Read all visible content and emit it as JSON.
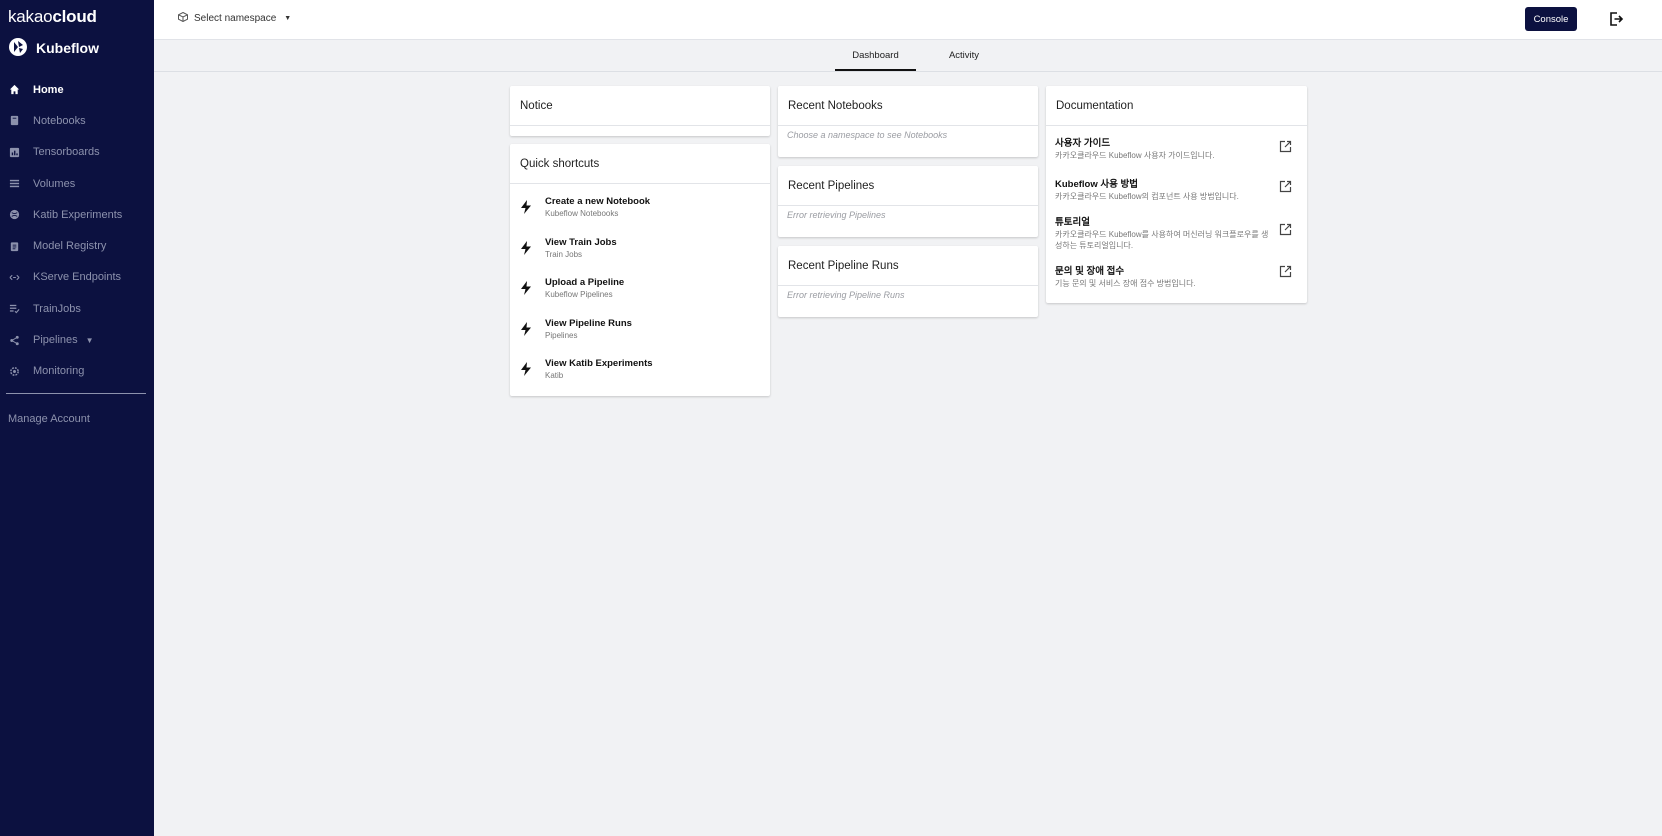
{
  "sidebar": {
    "brand_light": "kakao",
    "brand_bold": "cloud",
    "product": "Kubeflow",
    "items": [
      {
        "label": "Home",
        "icon": "home-icon"
      },
      {
        "label": "Notebooks",
        "icon": "book-icon"
      },
      {
        "label": "Tensorboards",
        "icon": "chart-icon"
      },
      {
        "label": "Volumes",
        "icon": "list-icon"
      },
      {
        "label": "Katib Experiments",
        "icon": "globe-icon"
      },
      {
        "label": "Model Registry",
        "icon": "clipboard-icon"
      },
      {
        "label": "KServe Endpoints",
        "icon": "arrows-icon"
      },
      {
        "label": "TrainJobs",
        "icon": "checklist-icon"
      },
      {
        "label": "Pipelines",
        "icon": "share-icon"
      },
      {
        "label": "Monitoring",
        "icon": "gear-icon"
      }
    ],
    "manage_account": "Manage Account"
  },
  "header": {
    "namespace_placeholder": "Select namespace",
    "console_label": "Console"
  },
  "tabs": [
    {
      "label": "Dashboard",
      "active": true
    },
    {
      "label": "Activity",
      "active": false
    }
  ],
  "notice": {
    "title": "Notice"
  },
  "shortcuts": {
    "title": "Quick shortcuts",
    "items": [
      {
        "title": "Create a new Notebook",
        "sub": "Kubeflow Notebooks"
      },
      {
        "title": "View Train Jobs",
        "sub": "Train Jobs"
      },
      {
        "title": "Upload a Pipeline",
        "sub": "Kubeflow Pipelines"
      },
      {
        "title": "View Pipeline Runs",
        "sub": "Pipelines"
      },
      {
        "title": "View Katib Experiments",
        "sub": "Katib"
      }
    ]
  },
  "recent_notebooks": {
    "title": "Recent Notebooks",
    "message": "Choose a namespace to see Notebooks"
  },
  "recent_pipelines": {
    "title": "Recent Pipelines",
    "message": "Error retrieving Pipelines"
  },
  "recent_runs": {
    "title": "Recent Pipeline Runs",
    "message": "Error retrieving Pipeline Runs"
  },
  "documentation": {
    "title": "Documentation",
    "items": [
      {
        "title": "사용자 가이드",
        "sub": "카카오클라우드 Kubeflow 사용자 가이드입니다."
      },
      {
        "title": "Kubeflow 사용 방법",
        "sub": "카카오클라우드 Kubeflow의 컴포넌트 사용 방법입니다."
      },
      {
        "title": "튜토리얼",
        "sub": "카카오클라우드 Kubeflow를 사용하여 머신러닝 워크플로우를 생성하는 튜토리얼입니다."
      },
      {
        "title": "문의 및 장애 접수",
        "sub": "기능 문의 및 서비스 장애 접수 방법입니다."
      }
    ]
  },
  "colors": {
    "sidebar_bg": "#0c1140",
    "page_bg": "#f1f2f4",
    "muted_text": "#8d92ad"
  }
}
